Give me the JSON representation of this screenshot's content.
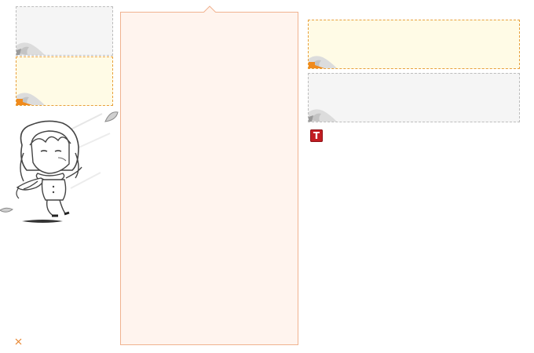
{
  "colors": {
    "panel_background": "#fff4ee",
    "panel_border": "#f0b28f",
    "swatch_grey": "#f5f5f5",
    "swatch_yellow": "#fffbe6",
    "accent_orange": "#e8a03c",
    "badge_red": "#c21d22"
  },
  "skin_swatches": [
    {
      "name": "grey",
      "color": "#f5f5f5"
    },
    {
      "name": "yellow",
      "color": "#fffbe6"
    },
    {
      "name": "yellow",
      "color": "#fffbe6"
    },
    {
      "name": "grey",
      "color": "#f5f5f5"
    }
  ],
  "badge": {
    "label": "T",
    "icon": "text-icon"
  },
  "close": {
    "icon": "close-icon"
  }
}
